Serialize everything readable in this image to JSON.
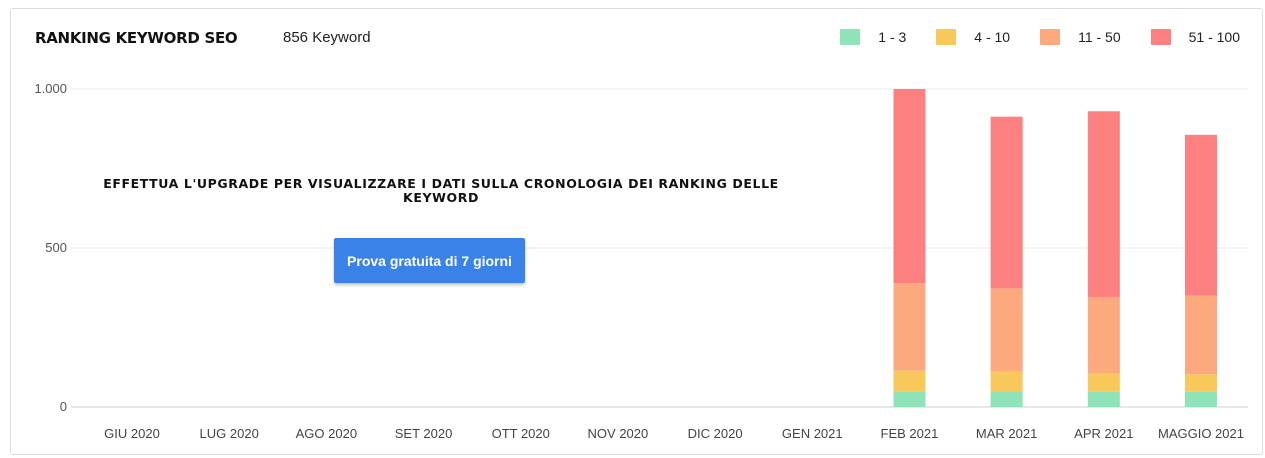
{
  "header": {
    "title": "RANKING KEYWORD SEO",
    "keyword_count": "856 Keyword"
  },
  "upsell": {
    "message": "EFFETTUA L'UPGRADE PER VISUALIZZARE I DATI SULLA CRONOLOGIA DEI RANKING DELLE KEYWORD",
    "button_label": "Prova gratuita di 7 giorni"
  },
  "colors": {
    "r1_3": "#8ee3b9",
    "r4_10": "#f9c85a",
    "r11_50": "#fba97d",
    "r51_100": "#fc8080",
    "button": "#3b82e8"
  },
  "chart_data": {
    "type": "bar",
    "stacked": true,
    "categories": [
      "GIU 2020",
      "LUG 2020",
      "AGO 2020",
      "SET 2020",
      "OTT 2020",
      "NOV 2020",
      "DIC 2020",
      "GEN 2021",
      "FEB 2021",
      "MAR 2021",
      "APR 2021",
      "MAGGIO 2021"
    ],
    "series": [
      {
        "name": "1 - 3",
        "color": "#8ee3b9",
        "values": [
          null,
          null,
          null,
          null,
          null,
          null,
          null,
          null,
          48,
          50,
          48,
          48
        ]
      },
      {
        "name": "4 - 10",
        "color": "#f9c85a",
        "values": [
          null,
          null,
          null,
          null,
          null,
          null,
          null,
          null,
          66,
          63,
          57,
          55
        ]
      },
      {
        "name": "11 - 50",
        "color": "#fba97d",
        "values": [
          null,
          null,
          null,
          null,
          null,
          null,
          null,
          null,
          275,
          260,
          240,
          247
        ]
      },
      {
        "name": "51 - 100",
        "color": "#fc8080",
        "values": [
          null,
          null,
          null,
          null,
          null,
          null,
          null,
          null,
          611,
          540,
          585,
          506
        ]
      }
    ],
    "yticks": [
      "0",
      "500",
      "1.000"
    ],
    "ytick_values": [
      0,
      500,
      1000
    ],
    "ylim": [
      0,
      1000
    ],
    "grid": true,
    "legend_position": "top-right"
  }
}
